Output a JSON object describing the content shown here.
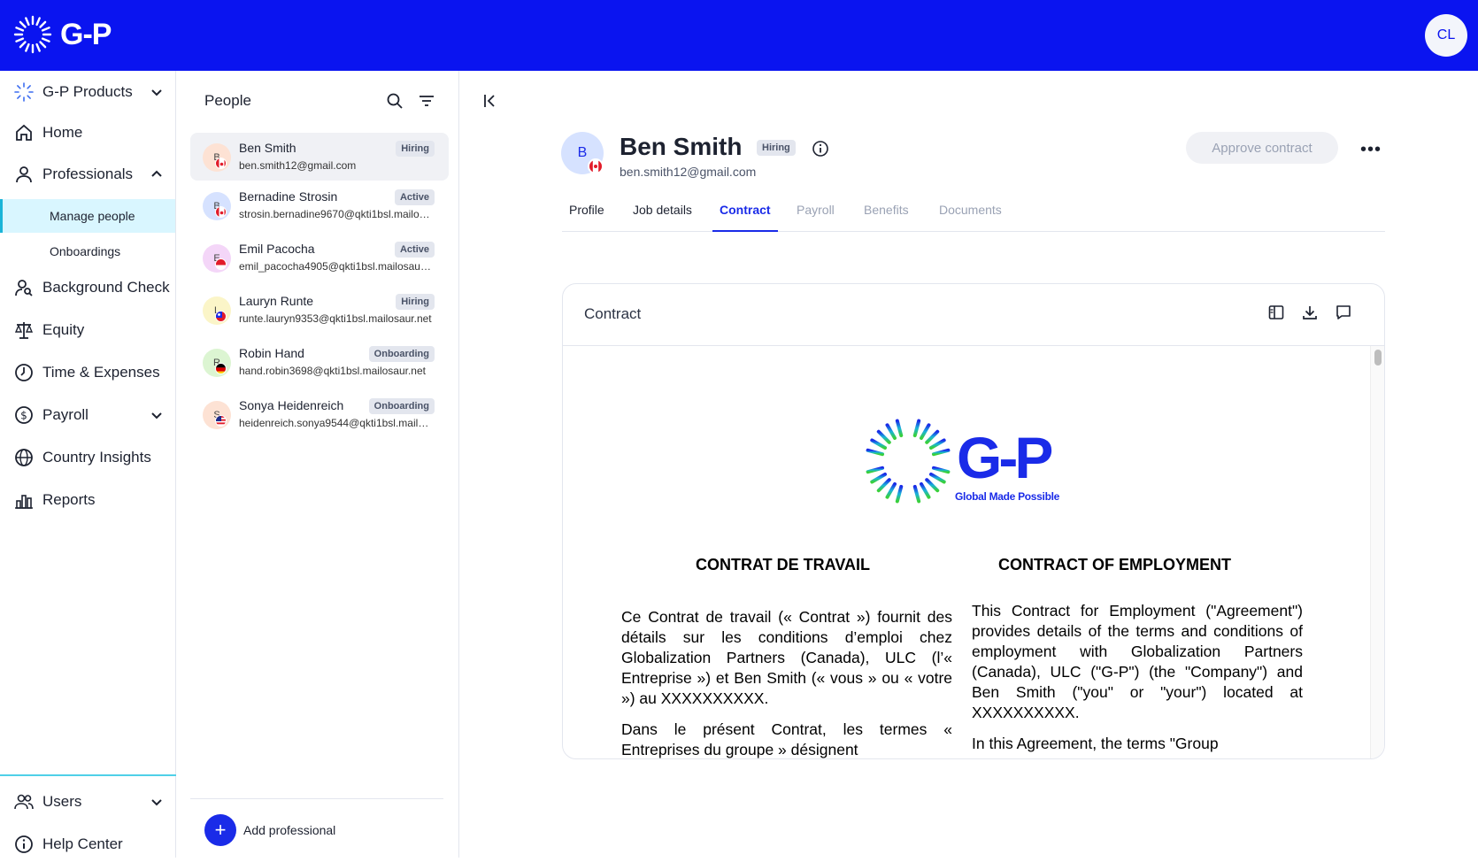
{
  "app": {
    "logo_text": "G-P",
    "user_initials": "CL"
  },
  "sidebar": {
    "product_switcher": "G-P Products",
    "items": [
      {
        "label": "Home",
        "icon": "home-icon"
      },
      {
        "label": "Professionals",
        "icon": "person-icon"
      },
      {
        "label": "Background Check",
        "icon": "person-search-icon"
      },
      {
        "label": "Equity",
        "icon": "scale-icon"
      },
      {
        "label": "Time & Expenses",
        "icon": "clock-icon"
      },
      {
        "label": "Payroll",
        "icon": "dollar-circle-icon"
      },
      {
        "label": "Country Insights",
        "icon": "globe-icon"
      },
      {
        "label": "Reports",
        "icon": "bar-chart-icon"
      }
    ],
    "sub_items": [
      {
        "label": "Manage people"
      },
      {
        "label": "Onboardings"
      }
    ],
    "bottom_items": [
      {
        "label": "Users",
        "icon": "users-icon"
      },
      {
        "label": "Help Center",
        "icon": "info-icon"
      }
    ]
  },
  "people": {
    "title": "People",
    "list": [
      {
        "initial": "B",
        "name": "Ben Smith",
        "email": "ben.smith12@gmail.com",
        "status": "Hiring",
        "flag": "canada"
      },
      {
        "initial": "B",
        "name": "Bernadine Strosin",
        "email": "strosin.bernadine9670@qkti1bsl.mailosaur.net",
        "status": "Active",
        "flag": "canada"
      },
      {
        "initial": "E",
        "name": "Emil Pacocha",
        "email": "emil_pacocha4905@qkti1bsl.mailosaur.net",
        "status": "Active",
        "flag": "singapore"
      },
      {
        "initial": "L",
        "name": "Lauryn Runte",
        "email": "runte.lauryn9353@qkti1bsl.mailosaur.net",
        "status": "Hiring",
        "flag": "taiwan"
      },
      {
        "initial": "R",
        "name": "Robin Hand",
        "email": "hand.robin3698@qkti1bsl.mailosaur.net",
        "status": "Onboarding",
        "flag": "germany"
      },
      {
        "initial": "S",
        "name": "Sonya Heidenreich",
        "email": "heidenreich.sonya9544@qkti1bsl.mailosaur.net",
        "status": "Onboarding",
        "flag": "usa"
      }
    ],
    "add_label": "Add professional"
  },
  "profile": {
    "initial": "B",
    "name": "Ben Smith",
    "status": "Hiring",
    "email": "ben.smith12@gmail.com",
    "approve_label": "Approve contract",
    "tabs": [
      "Profile",
      "Job details",
      "Contract",
      "Payroll",
      "Benefits",
      "Documents"
    ],
    "active_tab": "Contract"
  },
  "contract": {
    "title": "Contract",
    "logo_text": "G-P",
    "tagline": "Global Made Possible",
    "heading_fr": "CONTRAT DE TRAVAIL",
    "heading_en": "CONTRACT OF EMPLOYMENT",
    "para1_fr": "Ce Contrat de travail (« Contrat ») fournit des détails sur les conditions d’emploi chez Globalization Partners (Canada), ULC (l’« Entreprise ») et Ben Smith (« vous » ou « votre ») au XXXXXXXXXX.",
    "para2_fr": "Dans le présent Contrat, les termes « Entreprises du groupe » désignent",
    "para1_en": "This Contract for Employment (\"Agreement\") provides details of the terms and conditions of employment with Globalization Partners (Canada), ULC (\"G-P\") (the \"Company\") and Ben Smith (\"you\" or \"your\") located at XXXXXXXXXX.",
    "para2_en": "In this Agreement, the terms \"Group"
  }
}
